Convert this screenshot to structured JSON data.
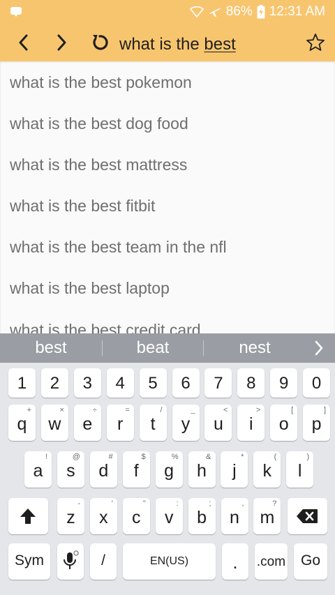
{
  "status_bar": {
    "battery": "86%",
    "time": "12:31 AM"
  },
  "toolbar": {
    "address_prefix": "what is the ",
    "address_typed": "best"
  },
  "suggestions": [
    "what is the best pokemon",
    "what is the best dog food",
    "what is the best mattress",
    "what is the best fitbit",
    "what is the best team in the nfl",
    "what is the best laptop",
    "what is the best credit card"
  ],
  "keyboard": {
    "predictions": [
      "best",
      "beat",
      "nest"
    ],
    "number_row": [
      "1",
      "2",
      "3",
      "4",
      "5",
      "6",
      "7",
      "8",
      "9",
      "0"
    ],
    "row1": [
      {
        "key": "q",
        "alt": "+"
      },
      {
        "key": "w",
        "alt": "×"
      },
      {
        "key": "e",
        "alt": "÷"
      },
      {
        "key": "r",
        "alt": "="
      },
      {
        "key": "t",
        "alt": "/"
      },
      {
        "key": "y",
        "alt": "_"
      },
      {
        "key": "u",
        "alt": "<"
      },
      {
        "key": "i",
        "alt": ">"
      },
      {
        "key": "o",
        "alt": "["
      },
      {
        "key": "p",
        "alt": "]"
      }
    ],
    "row2": [
      {
        "key": "a",
        "alt": "!"
      },
      {
        "key": "s",
        "alt": "@"
      },
      {
        "key": "d",
        "alt": "#"
      },
      {
        "key": "f",
        "alt": "$"
      },
      {
        "key": "g",
        "alt": "%"
      },
      {
        "key": "h",
        "alt": "&"
      },
      {
        "key": "j",
        "alt": "*"
      },
      {
        "key": "k",
        "alt": "("
      },
      {
        "key": "l",
        "alt": ")"
      }
    ],
    "row3": [
      {
        "key": "z",
        "alt": "-"
      },
      {
        "key": "x",
        "alt": "'"
      },
      {
        "key": "c",
        "alt": "\""
      },
      {
        "key": "v",
        "alt": ":"
      },
      {
        "key": "b",
        "alt": ";"
      },
      {
        "key": "n",
        "alt": ","
      },
      {
        "key": "m",
        "alt": "?"
      }
    ],
    "sym_label": "Sym",
    "slash_label": "/",
    "space_label": "EN(US)",
    "period_label": ".",
    "dotcom_label": ".com",
    "go_label": "Go"
  },
  "icons": {
    "back": "chevron-left-icon",
    "forward": "chevron-right-icon",
    "reload": "reload-icon",
    "bookmark": "star-outline-icon",
    "shift": "shift-arrow-icon",
    "backspace": "backspace-icon",
    "voice": "microphone-icon"
  },
  "colors": {
    "toolbar": "#f8c56f",
    "suggestion_text": "#6f6f6f",
    "prediction_bar": "#9a9da3",
    "keyboard_bg": "#e4e6ea"
  }
}
